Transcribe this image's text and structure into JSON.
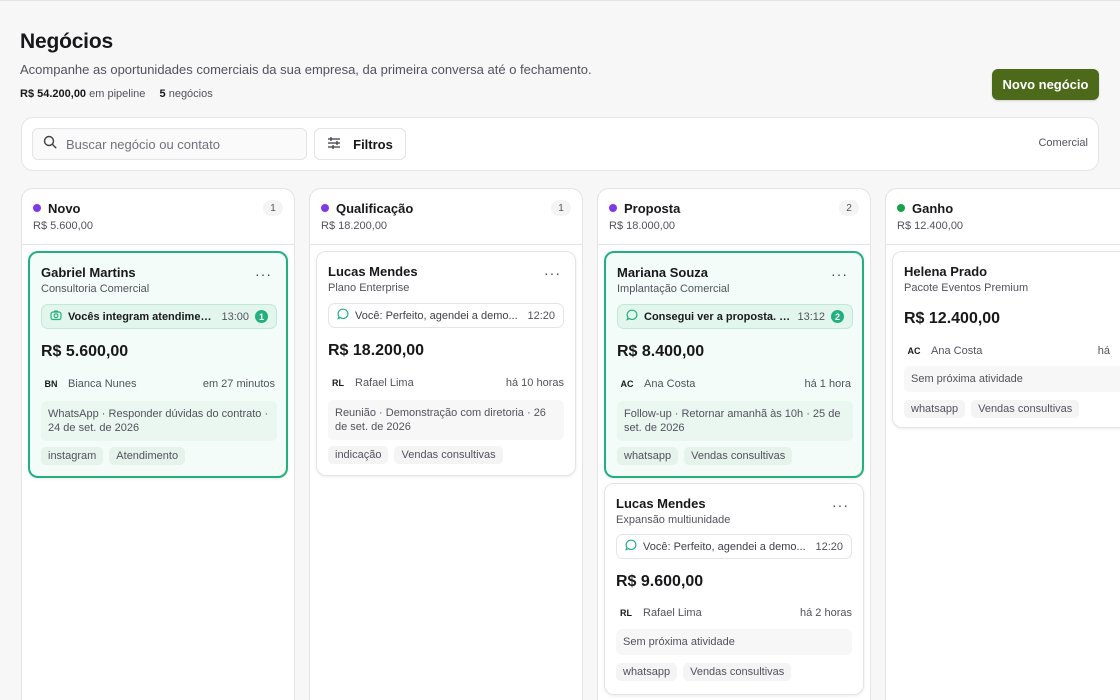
{
  "header": {
    "title": "Negócios",
    "subtitle": "Acompanhe as oportunidades comerciais da sua empresa, da primeira conversa até o fechamento.",
    "pipeline_value": "R$ 54.200,00",
    "pipeline_label": "em pipeline",
    "deals_count": "5",
    "deals_label": "negócios",
    "new_button": "Novo negócio"
  },
  "toolbar": {
    "search_placeholder": "Buscar negócio ou contato",
    "filters_label": "Filtros",
    "pipeline_name": "Comercial"
  },
  "colors": {
    "accent_button": "#4d6a1a",
    "active_border": "#22b07d",
    "stage_novo": "#7c3aed",
    "stage_qualificacao": "#7c3aed",
    "stage_proposta": "#7c3aed",
    "stage_ganho": "#16a34a"
  },
  "columns": [
    {
      "title": "Novo",
      "count": "1",
      "total": "R$ 5.600,00",
      "cards": [
        {
          "name": "Gabriel Martins",
          "subtitle": "Consultoria Comercial",
          "menu": "···",
          "message_icon": "camera-icon",
          "message": "Vocês integram atendiment...",
          "message_time": "13:00",
          "unread": "1",
          "amount": "R$ 5.600,00",
          "owner_initials": "BN",
          "owner_name": "Bianca Nunes",
          "owner_when": "em 27 minutos",
          "activity": "WhatsApp · Responder dúvidas do contrato · 24 de set. de 2026",
          "tags": [
            "instagram",
            "Atendimento"
          ]
        }
      ]
    },
    {
      "title": "Qualificação",
      "count": "1",
      "total": "R$ 18.200,00",
      "cards": [
        {
          "name": "Lucas Mendes",
          "subtitle": "Plano Enterprise",
          "menu": "···",
          "message_icon": "chat-bubble-icon",
          "message": "Você: Perfeito, agendei a demo...",
          "message_time": "12:20",
          "amount": "R$ 18.200,00",
          "owner_initials": "RL",
          "owner_name": "Rafael Lima",
          "owner_when": "há 10 horas",
          "activity": "Reunião · Demonstração com diretoria · 26 de set. de 2026",
          "tags": [
            "indicação",
            "Vendas consultivas"
          ]
        }
      ]
    },
    {
      "title": "Proposta",
      "count": "2",
      "total": "R$ 18.000,00",
      "cards": [
        {
          "name": "Mariana Souza",
          "subtitle": "Implantação Comercial",
          "menu": "···",
          "message_icon": "chat-bubble-icon",
          "message": "Consegui ver a proposta. P...",
          "message_time": "13:12",
          "unread": "2",
          "amount": "R$ 8.400,00",
          "owner_initials": "AC",
          "owner_name": "Ana Costa",
          "owner_when": "há 1 hora",
          "activity": "Follow-up · Retornar amanhã às 10h · 25 de set. de 2026",
          "tags": [
            "whatsapp",
            "Vendas consultivas"
          ]
        },
        {
          "name": "Lucas Mendes",
          "subtitle": "Expansão multiunidade",
          "menu": "···",
          "message_icon": "chat-bubble-icon",
          "message": "Você: Perfeito, agendei a demo...",
          "message_time": "12:20",
          "amount": "R$ 9.600,00",
          "owner_initials": "RL",
          "owner_name": "Rafael Lima",
          "owner_when": "há 2 horas",
          "activity": "Sem próxima atividade",
          "tags": [
            "whatsapp",
            "Vendas consultivas"
          ]
        }
      ]
    },
    {
      "title": "Ganho",
      "count": "",
      "total": "R$ 12.400,00",
      "cards": [
        {
          "name": "Helena Prado",
          "subtitle": "Pacote Eventos Premium",
          "amount": "R$ 12.400,00",
          "owner_initials": "AC",
          "owner_name": "Ana Costa",
          "owner_when": "há",
          "activity": "Sem próxima atividade",
          "tags": [
            "whatsapp",
            "Vendas consultivas"
          ]
        }
      ]
    }
  ]
}
